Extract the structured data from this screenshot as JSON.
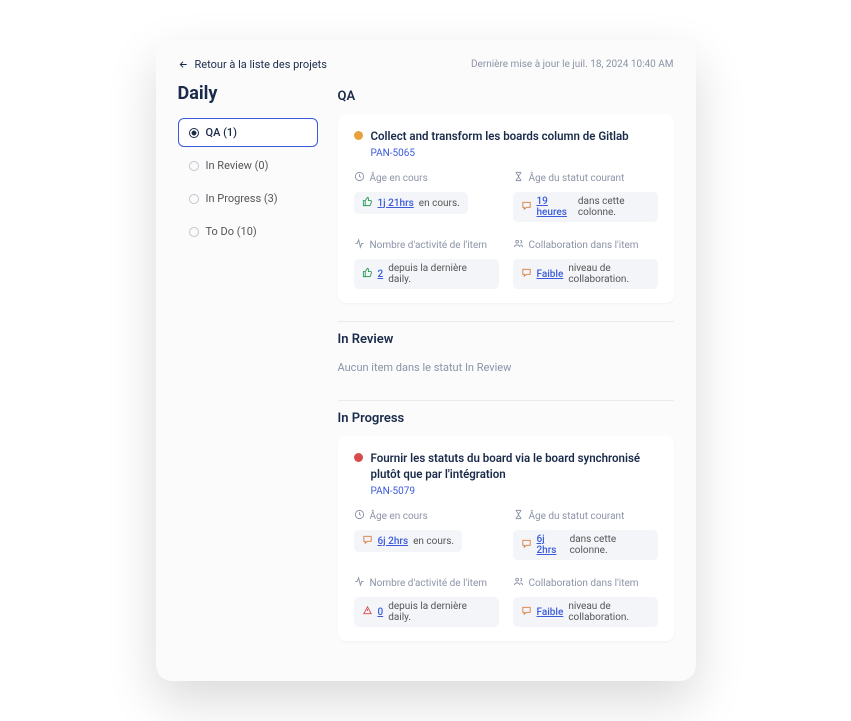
{
  "back_label": "Retour à la liste des projets",
  "updated": "Dernière mise à jour le juil. 18, 2024 10:40 AM",
  "title": "Daily",
  "tabs": [
    {
      "label": "QA (1)",
      "active": true
    },
    {
      "label": "In Review (0)",
      "active": false
    },
    {
      "label": "In Progress (3)",
      "active": false
    },
    {
      "label": "To Do (10)",
      "active": false
    }
  ],
  "labels": {
    "age": "Âge en cours",
    "status_age": "Âge du statut courant",
    "activity": "Nombre d'activité de l'item",
    "collab": "Collaboration dans l'item",
    "en_cours": "en cours.",
    "dans_colonne": "dans cette colonne.",
    "depuis_daily": "depuis la dernière daily.",
    "niveau_collab": "niveau de collaboration."
  },
  "sections": [
    {
      "heading": "QA",
      "items": [
        {
          "dot": "#e8a23d",
          "title": "Collect and transform les boards column de Gitlab",
          "key": "PAN-5065",
          "age": {
            "v": "1j 21hrs",
            "tone": "green"
          },
          "status": {
            "v": "19 heures",
            "tone": "orange"
          },
          "activity": {
            "v": "2",
            "tone": "green"
          },
          "collab": {
            "v": "Faible",
            "tone": "orange"
          }
        }
      ]
    },
    {
      "heading": "In Review",
      "empty": "Aucun item dans le statut In Review"
    },
    {
      "heading": "In Progress",
      "items": [
        {
          "dot": "#d94a4a",
          "title": "Fournir les statuts du board via le board synchronisé plutôt que par l'intégration",
          "key": "PAN-5079",
          "age": {
            "v": "6j 2hrs",
            "tone": "orange"
          },
          "status": {
            "v": "6j 2hrs",
            "tone": "orange"
          },
          "activity": {
            "v": "0",
            "tone": "red"
          },
          "collab": {
            "v": "Faible",
            "tone": "orange"
          }
        }
      ]
    }
  ]
}
